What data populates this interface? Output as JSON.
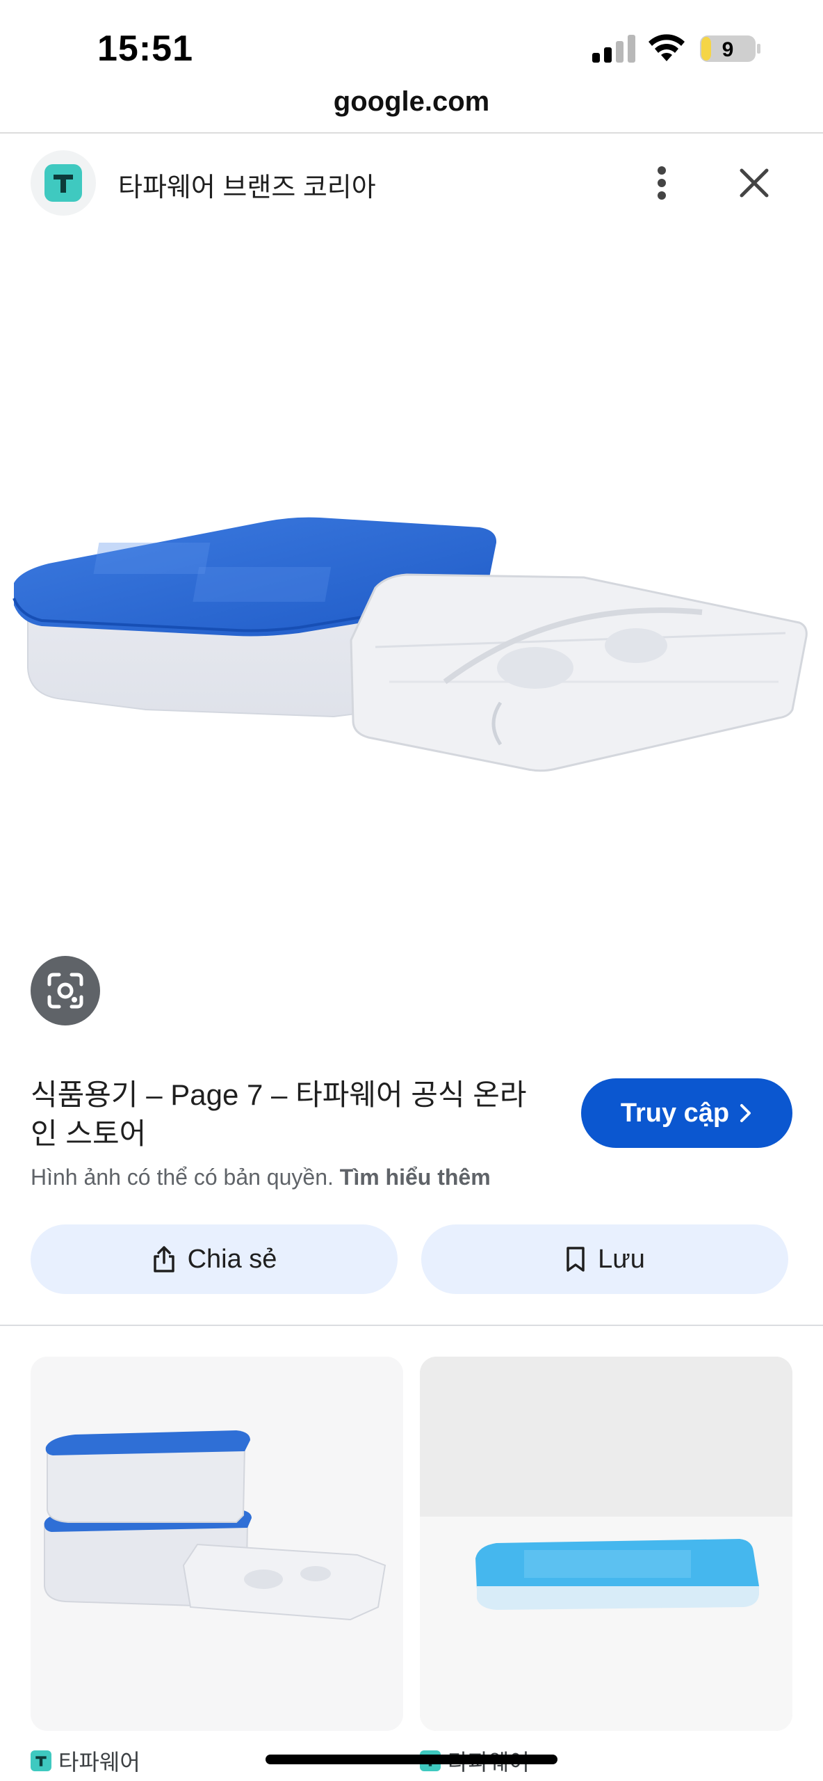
{
  "status_bar": {
    "time": "15:51",
    "battery_level": "9",
    "icons": [
      "cellular-signal-icon",
      "wifi-icon",
      "battery-icon"
    ]
  },
  "browser": {
    "url": "google.com"
  },
  "source": {
    "site_name": "타파웨어 브랜즈 코리아",
    "logo_letter": "T",
    "icons": [
      "more-vert-icon",
      "close-icon"
    ]
  },
  "result": {
    "title": "식품용기 – Page 7 – 타파웨어 공식 온라인 스토어",
    "visit_label": "Truy cập",
    "copyright_text": "Hình ảnh có thể có bản quyền.",
    "learn_more": "Tìm hiểu thêm",
    "share_label": "Chia sẻ",
    "save_label": "Lưu"
  },
  "related": [
    {
      "source_name": "타파웨어"
    },
    {
      "source_name": "타파웨어"
    }
  ],
  "colors": {
    "accent": "#0b57d0",
    "action_bg": "#e8f0fe",
    "lid_blue": "#2f6fd6",
    "lid_light_blue": "#45b7ee",
    "brand_teal": "#3fc9c0",
    "battery_yellow": "#f5d547"
  }
}
